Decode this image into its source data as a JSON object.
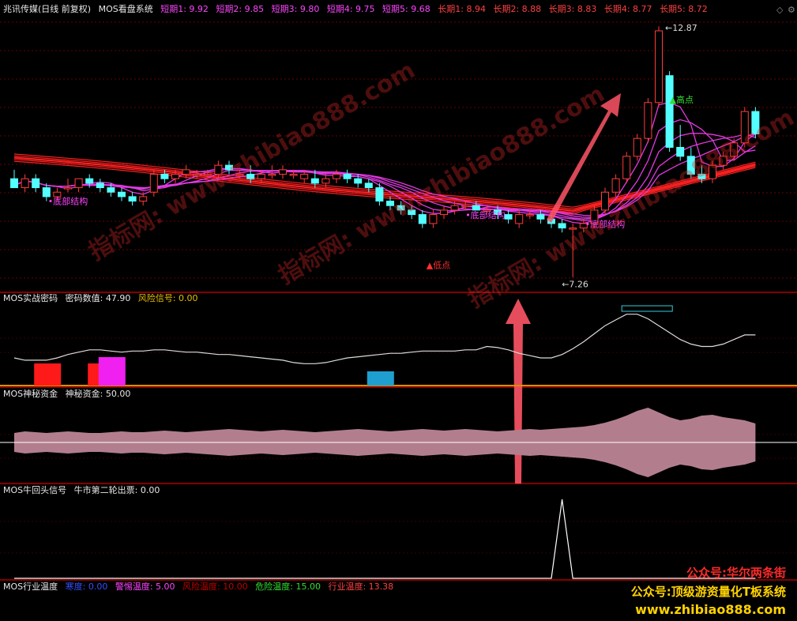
{
  "colors": {
    "bg": "#000000",
    "up": "#ff3b3b",
    "down": "#54ffff",
    "magenta": "#e23ae2",
    "red_line": "#ff2020",
    "grid": "#6a0000",
    "divider": "#b00000",
    "white_line": "#dcdcdc",
    "mystic_fill": "#b27e8e",
    "orange": "#d99000"
  },
  "header": {
    "stock_name": "兆讯传媒(日线 前复权)",
    "indicator": "MOS看盘系统",
    "short_periods": [
      "短期1: 9.92",
      "短期2: 9.85",
      "短期3: 9.80",
      "短期4: 9.75",
      "短期5: 9.68"
    ],
    "long_periods": [
      "长期1: 8.94",
      "长期2: 8.88",
      "长期3: 8.83",
      "长期4: 8.77",
      "长期5: 8.72"
    ]
  },
  "window_controls": {
    "diamond_icon": "◇",
    "settings_icon": "⚙"
  },
  "main_annotations": {
    "high_price": "12.87",
    "high_point": "▲高点",
    "low_price": "7.26",
    "low_point": "▲低点",
    "bottom_structure": "•底部结构"
  },
  "panels": {
    "secret": {
      "title": "MOS实战密码",
      "value": "密码数值: 47.90",
      "risk": "风险信号: 0.00"
    },
    "fund": {
      "title": "MOS神秘资金",
      "value": "神秘资金: 50.00"
    },
    "bull": {
      "title": "MOS牛回头信号",
      "value": "牛市第二轮出票: 0.00"
    },
    "temp": {
      "title": "MOS行业温度",
      "items": [
        "寒度: 0.00",
        "警惕温度: 5.00",
        "风险温度: 10.00",
        "危险温度: 15.00",
        "行业温度: 13.38"
      ]
    }
  },
  "watermark": {
    "line1": "公众号:华尔两条街",
    "line2": "公众号:顶级游资量化T板系统",
    "line3": "www.zhibiao888.com",
    "diagonal": [
      "指标网: www.zhibiao888.com",
      "指标网: www.zhibiao888.com",
      "指标网: www.zhibiao888.com"
    ]
  },
  "chart_data": {
    "type": "candlestick",
    "ylim": [
      7.0,
      13.1
    ],
    "candles": [
      [
        9.5,
        9.7,
        9.3,
        9.3
      ],
      [
        9.3,
        9.6,
        9.2,
        9.5
      ],
      [
        9.5,
        9.6,
        9.2,
        9.3
      ],
      [
        9.3,
        9.4,
        9.0,
        9.1
      ],
      [
        9.1,
        9.3,
        9.0,
        9.2
      ],
      [
        9.3,
        9.5,
        9.2,
        9.3
      ],
      [
        9.3,
        9.5,
        9.2,
        9.5
      ],
      [
        9.5,
        9.6,
        9.3,
        9.4
      ],
      [
        9.4,
        9.5,
        9.2,
        9.3
      ],
      [
        9.3,
        9.4,
        9.1,
        9.2
      ],
      [
        9.2,
        9.3,
        9.0,
        9.1
      ],
      [
        9.1,
        9.2,
        8.9,
        9.0
      ],
      [
        9.0,
        9.2,
        8.9,
        9.1
      ],
      [
        9.2,
        9.7,
        9.1,
        9.6
      ],
      [
        9.6,
        9.7,
        9.4,
        9.5
      ],
      [
        9.5,
        9.7,
        9.4,
        9.6
      ],
      [
        9.6,
        9.8,
        9.5,
        9.7
      ],
      [
        9.6,
        9.7,
        9.5,
        9.6
      ],
      [
        9.6,
        9.7,
        9.5,
        9.6
      ],
      [
        9.6,
        9.9,
        9.5,
        9.8
      ],
      [
        9.8,
        9.9,
        9.6,
        9.7
      ],
      [
        9.6,
        9.7,
        9.5,
        9.6
      ],
      [
        9.6,
        9.8,
        9.4,
        9.5
      ],
      [
        9.5,
        9.7,
        9.4,
        9.6
      ],
      [
        9.6,
        9.8,
        9.5,
        9.6
      ],
      [
        9.6,
        9.8,
        9.5,
        9.7
      ],
      [
        9.6,
        9.7,
        9.5,
        9.6
      ],
      [
        9.5,
        9.7,
        9.4,
        9.6
      ],
      [
        9.5,
        9.7,
        9.3,
        9.4
      ],
      [
        9.4,
        9.6,
        9.3,
        9.5
      ],
      [
        9.5,
        9.7,
        9.4,
        9.6
      ],
      [
        9.6,
        9.7,
        9.4,
        9.5
      ],
      [
        9.5,
        9.6,
        9.3,
        9.4
      ],
      [
        9.4,
        9.5,
        9.2,
        9.3
      ],
      [
        9.3,
        9.4,
        8.9,
        9.0
      ],
      [
        9.0,
        9.1,
        8.8,
        8.9
      ],
      [
        8.9,
        9.0,
        8.7,
        8.8
      ],
      [
        8.8,
        8.9,
        8.6,
        8.7
      ],
      [
        8.7,
        8.8,
        8.4,
        8.5
      ],
      [
        8.5,
        8.8,
        8.4,
        8.7
      ],
      [
        8.7,
        8.9,
        8.6,
        8.8
      ],
      [
        8.8,
        9.0,
        8.7,
        8.9
      ],
      [
        8.9,
        9.0,
        8.8,
        8.9
      ],
      [
        8.9,
        9.0,
        8.8,
        8.8
      ],
      [
        8.8,
        8.9,
        8.7,
        8.8
      ],
      [
        8.8,
        8.9,
        8.6,
        8.7
      ],
      [
        8.7,
        8.8,
        8.5,
        8.6
      ],
      [
        8.5,
        8.8,
        8.4,
        8.7
      ],
      [
        8.7,
        8.8,
        8.6,
        8.7
      ],
      [
        8.7,
        8.8,
        8.5,
        8.6
      ],
      [
        8.6,
        8.7,
        8.4,
        8.5
      ],
      [
        8.5,
        8.6,
        8.3,
        8.4
      ],
      [
        8.4,
        8.5,
        7.3,
        8.4
      ],
      [
        8.4,
        8.6,
        8.3,
        8.5
      ],
      [
        8.5,
        8.9,
        8.4,
        8.8
      ],
      [
        8.8,
        9.3,
        8.7,
        9.2
      ],
      [
        9.2,
        9.6,
        9.1,
        9.5
      ],
      [
        9.5,
        10.1,
        9.4,
        10.0
      ],
      [
        10.0,
        10.5,
        9.9,
        10.4
      ],
      [
        10.4,
        11.3,
        10.3,
        11.2
      ],
      [
        11.2,
        12.9,
        11.1,
        12.8
      ],
      [
        11.8,
        11.9,
        10.1,
        10.2
      ],
      [
        10.2,
        10.7,
        9.9,
        10.0
      ],
      [
        10.0,
        10.2,
        9.5,
        9.6
      ],
      [
        9.6,
        9.8,
        9.4,
        9.5
      ],
      [
        9.5,
        9.9,
        9.4,
        9.8
      ],
      [
        9.8,
        10.1,
        9.7,
        10.0
      ],
      [
        10.0,
        10.4,
        9.9,
        10.3
      ],
      [
        10.3,
        11.1,
        10.2,
        11.0
      ],
      [
        11.0,
        11.1,
        10.4,
        10.5
      ]
    ],
    "secret_line": [
      24,
      22,
      22,
      22,
      24,
      27,
      29,
      31,
      31,
      30,
      29,
      30,
      30,
      31,
      31,
      30,
      29,
      29,
      28,
      27,
      27,
      26,
      25,
      24,
      23,
      22,
      20,
      19,
      19,
      20,
      22,
      24,
      25,
      26,
      27,
      28,
      28,
      29,
      30,
      30,
      30,
      30,
      31,
      31,
      34,
      33,
      31,
      28,
      26,
      24,
      24,
      27,
      32,
      38,
      45,
      52,
      57,
      62,
      62,
      58,
      52,
      46,
      40,
      36,
      34,
      34,
      36,
      40,
      44,
      44
    ],
    "secret_bars": [
      {
        "index": 2,
        "color": "#ff1a1a",
        "height": 28
      },
      {
        "index": 7,
        "color": "#ff1a1a",
        "height": 28
      },
      {
        "index": 8,
        "color": "#f020f0",
        "height": 36
      },
      {
        "index": 33,
        "color": "#1e9fd0",
        "height": 18
      }
    ],
    "mystic_fund": [
      12,
      14,
      13,
      12,
      13,
      14,
      13,
      12,
      12,
      13,
      14,
      13,
      13,
      14,
      15,
      14,
      13,
      14,
      15,
      16,
      17,
      16,
      15,
      14,
      15,
      16,
      15,
      14,
      13,
      14,
      15,
      16,
      17,
      16,
      15,
      14,
      15,
      16,
      17,
      16,
      15,
      16,
      17,
      16,
      15,
      14,
      15,
      16,
      17,
      16,
      17,
      18,
      19,
      20,
      22,
      25,
      29,
      34,
      40,
      44,
      38,
      32,
      28,
      30,
      34,
      35,
      32,
      30,
      28,
      24
    ],
    "bull_signal": [
      0,
      0,
      0,
      0,
      0,
      0,
      0,
      0,
      0,
      0,
      0,
      0,
      0,
      0,
      0,
      0,
      0,
      0,
      0,
      0,
      0,
      0,
      0,
      0,
      0,
      0,
      0,
      0,
      0,
      0,
      0,
      0,
      0,
      0,
      0,
      0,
      0,
      0,
      0,
      0,
      0,
      0,
      0,
      0,
      0,
      0,
      0,
      0,
      0,
      0,
      0,
      1,
      0,
      0,
      0,
      0,
      0,
      0,
      0,
      0,
      0,
      0,
      0,
      0,
      0,
      0,
      0,
      0,
      0,
      0
    ]
  }
}
